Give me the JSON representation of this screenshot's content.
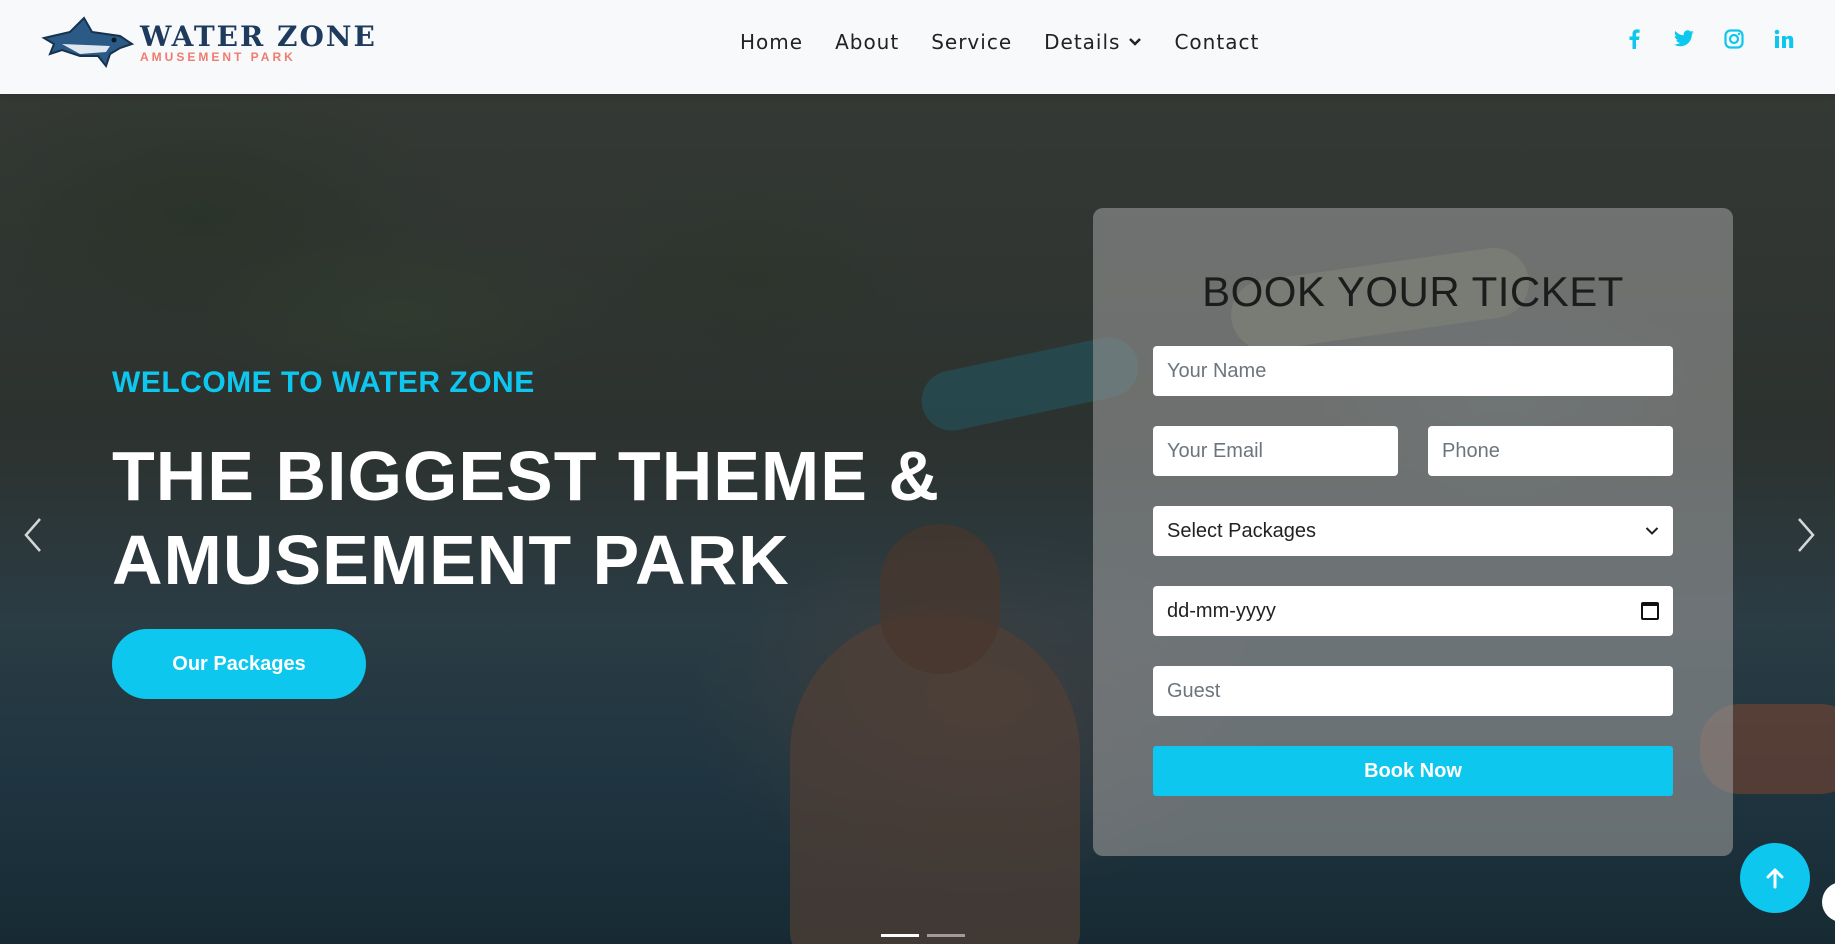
{
  "brand": {
    "name": "WATER ZONE",
    "tagline": "AMUSEMENT PARK"
  },
  "nav": {
    "items": [
      {
        "label": "Home"
      },
      {
        "label": "About"
      },
      {
        "label": "Service"
      },
      {
        "label": "Details"
      },
      {
        "label": "Contact"
      }
    ]
  },
  "socials": {
    "facebook": "f",
    "twitter": "twitter",
    "instagram": "instagram",
    "linkedin": "in"
  },
  "hero": {
    "welcome": "WELCOME TO WATER ZONE",
    "headline_line1": "THE BIGGEST THEME &",
    "headline_line2": "AMUSEMENT PARK",
    "cta": "Our Packages",
    "slide_count": 2,
    "active_slide": 1
  },
  "booking": {
    "title": "BOOK YOUR TICKET",
    "name_placeholder": "Your Name",
    "email_placeholder": "Your Email",
    "phone_placeholder": "Phone",
    "package_selected": "Select Packages",
    "date_placeholder": "dd-mm-yyyy",
    "guest_placeholder": "Guest",
    "submit_label": "Book Now"
  },
  "colors": {
    "accent": "#0dc7ee",
    "navbar_bg": "#f7f9fb",
    "logo_navy": "#1e3a5c",
    "logo_coral": "#f07b6e"
  }
}
